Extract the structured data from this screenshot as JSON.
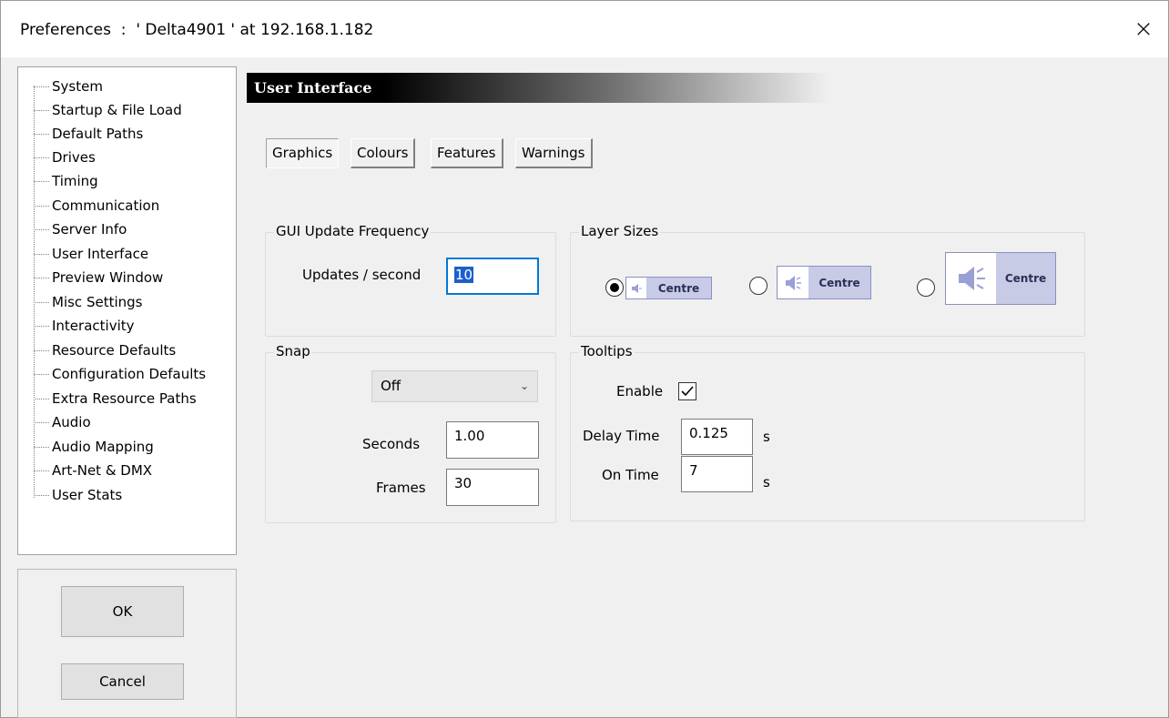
{
  "window": {
    "title": "Preferences  :  ' Delta4901 ' at 192.168.1.182",
    "close_glyph": "×"
  },
  "tree": {
    "items": [
      "System",
      "Startup & File Load",
      "Default Paths",
      "Drives",
      "Timing",
      "Communication",
      "Server Info",
      "User Interface",
      "Preview Window",
      "Misc Settings",
      "Interactivity",
      "Resource Defaults",
      "Configuration Defaults",
      "Extra Resource Paths",
      "Audio",
      "Audio Mapping",
      "Art-Net & DMX",
      "User Stats"
    ],
    "selected": "User Interface"
  },
  "buttons": {
    "ok": "OK",
    "cancel": "Cancel"
  },
  "header": {
    "title": "User Interface"
  },
  "tabs": [
    "Graphics",
    "Colours",
    "Features",
    "Warnings"
  ],
  "active_tab": "Graphics",
  "gui_update": {
    "title": "GUI Update Frequency",
    "label": "Updates / second",
    "value": "10"
  },
  "layer_sizes": {
    "title": "Layer Sizes",
    "options": [
      {
        "label": "Centre",
        "selected": true,
        "icon": "speaker-icon-small"
      },
      {
        "label": "Centre",
        "selected": false,
        "icon": "speaker-icon-medium"
      },
      {
        "label": "Centre",
        "selected": false,
        "icon": "speaker-icon-large"
      }
    ]
  },
  "snap": {
    "title": "Snap",
    "dropdown_value": "Off",
    "seconds_label": "Seconds",
    "seconds_value": "1.00",
    "frames_label": "Frames",
    "frames_value": "30"
  },
  "tooltips": {
    "title": "Tooltips",
    "enable_label": "Enable",
    "enabled": true,
    "delay_label": "Delay Time",
    "delay_value": "0.125",
    "delay_unit": "s",
    "on_label": "On Time",
    "on_value": "7",
    "on_unit": "s"
  },
  "colors": {
    "preview_fill": "#c7cbe6",
    "preview_border": "#8c8fc0",
    "speaker_icon": "#9aa0d6",
    "focus_border": "#0078d7"
  }
}
